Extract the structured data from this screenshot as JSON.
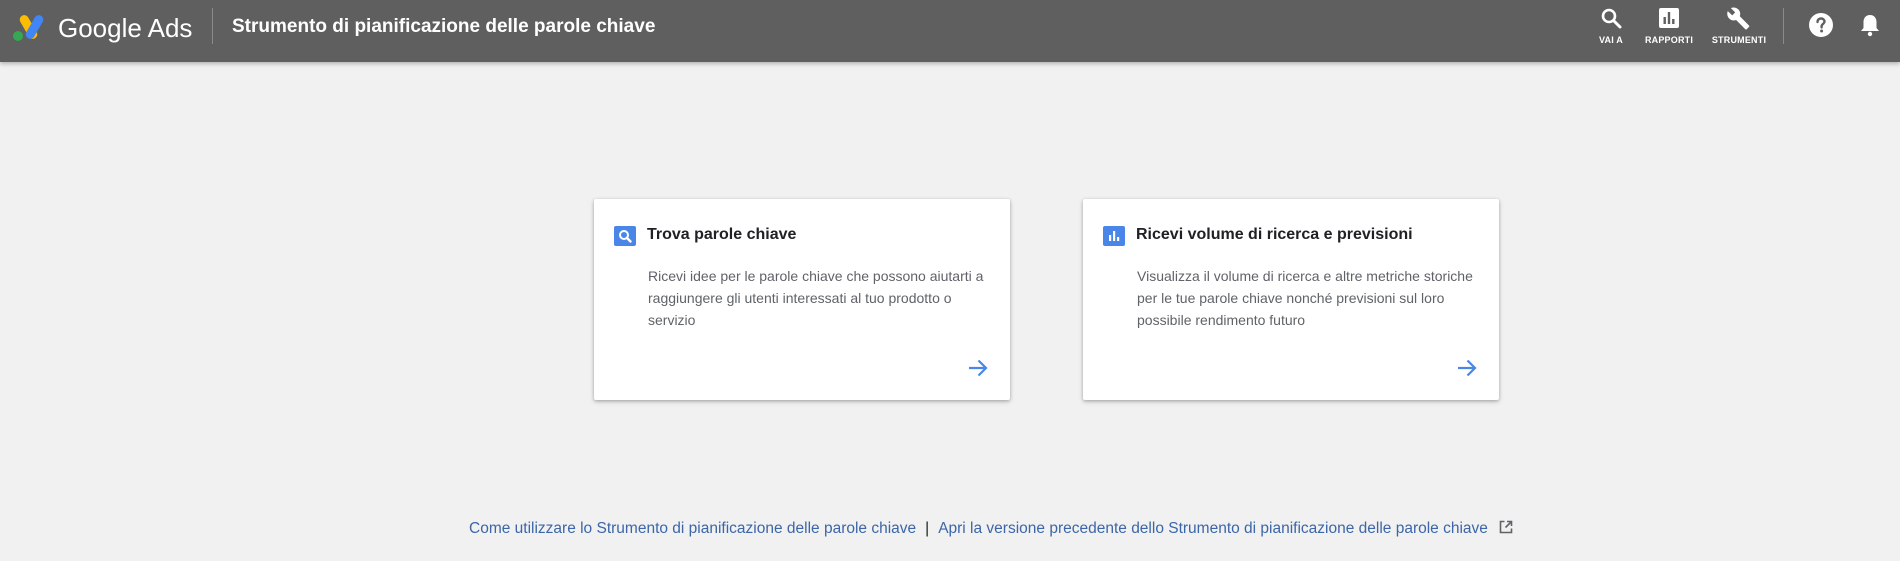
{
  "header": {
    "brand": "Google Ads",
    "page_title": "Strumento di pianificazione delle parole chiave",
    "nav": [
      {
        "label": "VAI A",
        "icon": "search-icon"
      },
      {
        "label": "RAPPORTI",
        "icon": "bar-chart-icon"
      },
      {
        "label": "STRUMENTI",
        "icon": "wrench-icon"
      }
    ],
    "help_icon": "help-icon",
    "notifications_icon": "bell-icon"
  },
  "cards": [
    {
      "icon": "search-icon",
      "title": "Trova parole chiave",
      "description": "Ricevi idee per le parole chiave che possono aiutarti a raggiungere gli utenti interessati al tuo prodotto o servizio",
      "action_icon": "arrow-right-icon"
    },
    {
      "icon": "bar-chart-icon",
      "title": "Ricevi volume di ricerca e previsioni",
      "description": "Visualizza il volume di ricerca e altre metriche storiche per le tue parole chiave nonché previsioni sul loro possibile rendimento futuro",
      "action_icon": "arrow-right-icon"
    }
  ],
  "footer": {
    "link_how_to": "Come utilizzare lo Strumento di pianificazione delle parole chiave",
    "separator": "|",
    "link_old_version": "Apri la versione precedente dello Strumento di pianificazione delle parole chiave"
  },
  "colors": {
    "topbar": "#5f5f5f",
    "background": "#f1f1f1",
    "accent_blue": "#4a86e8",
    "link": "#3c66a8"
  }
}
